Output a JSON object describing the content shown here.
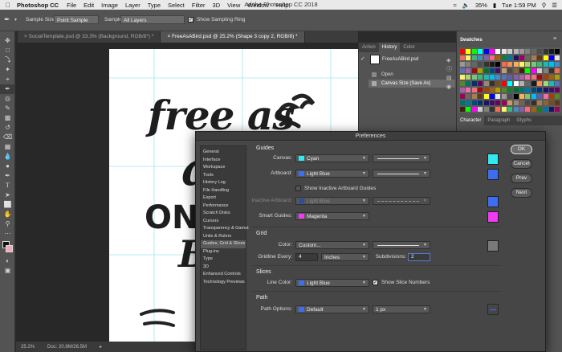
{
  "menubar": {
    "apple": "",
    "app": "Photoshop CC",
    "items": [
      "File",
      "Edit",
      "Image",
      "Layer",
      "Type",
      "Select",
      "Filter",
      "3D",
      "View",
      "Window",
      "Help"
    ],
    "title": "Adobe Photoshop CC 2018",
    "battery": "35%",
    "time": "Tue 1:59 PM"
  },
  "options": {
    "sample_size_label": "Sample Size:",
    "sample_size_value": "Point Sample",
    "sample_label": "Sample:",
    "sample_value": "All Layers",
    "ring_label": "Show Sampling Ring"
  },
  "tabs": [
    {
      "label": "SocialTemplate.psd @ 33.3% (Background, RGB/8*) *"
    },
    {
      "label": "FreeAsABird.psd @ 25.2% (Shape 3 copy 2, RGB/8) *"
    }
  ],
  "artwork": {
    "line1": "free as",
    "line2": "a",
    "line3": "ON T",
    "line4": "B"
  },
  "statusbar": {
    "zoom": "25.2%",
    "doc": "Doc: 20.8M/26.5M"
  },
  "history": {
    "tabs": [
      "Action",
      "History",
      "Color"
    ],
    "snapshot": "FreeAsABird.psd",
    "items": [
      "Open",
      "Canvas Size (Save As)"
    ]
  },
  "swatches": {
    "title": "Swatches"
  },
  "character": {
    "tabs": [
      "Character",
      "Paragraph",
      "Glyphs"
    ]
  },
  "dialog": {
    "title": "Preferences",
    "categories": [
      "General",
      "Interface",
      "Workspace",
      "Tools",
      "History Log",
      "File Handling",
      "Export",
      "Performance",
      "Scratch Disks",
      "Cursors",
      "Transparency & Gamut",
      "Units & Rulers",
      "Guides, Grid & Slices",
      "Plug-ins",
      "Type",
      "3D",
      "Enhanced Controls",
      "Technology Previews"
    ],
    "selected_category": "Guides, Grid & Slices",
    "guides": {
      "title": "Guides",
      "canvas_label": "Canvas:",
      "canvas_value": "Cyan",
      "artboard_label": "Artboard:",
      "artboard_value": "Light Blue",
      "inactive_checkbox": "Show Inactive Artboard Guides",
      "inactive_label": "Inactive Artboard:",
      "inactive_value": "Light Blue",
      "smart_label": "Smart Guides:",
      "smart_value": "Magenta"
    },
    "grid": {
      "title": "Grid",
      "color_label": "Color:",
      "color_value": "Custom...",
      "gridline_label": "Gridline Every:",
      "gridline_value": "4",
      "unit_value": "Inches",
      "subdiv_label": "Subdivisions:",
      "subdiv_value": "2"
    },
    "slices": {
      "title": "Slices",
      "line_color_label": "Line Color:",
      "line_color_value": "Light Blue",
      "show_numbers": "Show Slice Numbers"
    },
    "path": {
      "title": "Path",
      "options_label": "Path Options:",
      "options_value": "Default",
      "width_value": "1 px"
    },
    "buttons": {
      "ok": "OK",
      "cancel": "Cancel",
      "prev": "Prev",
      "next": "Next"
    }
  },
  "colors": {
    "cyan": "#33e8f0",
    "light_blue": "#3d6ef0",
    "magenta": "#f03cf0",
    "grid_gray": "#7a7a7a"
  }
}
